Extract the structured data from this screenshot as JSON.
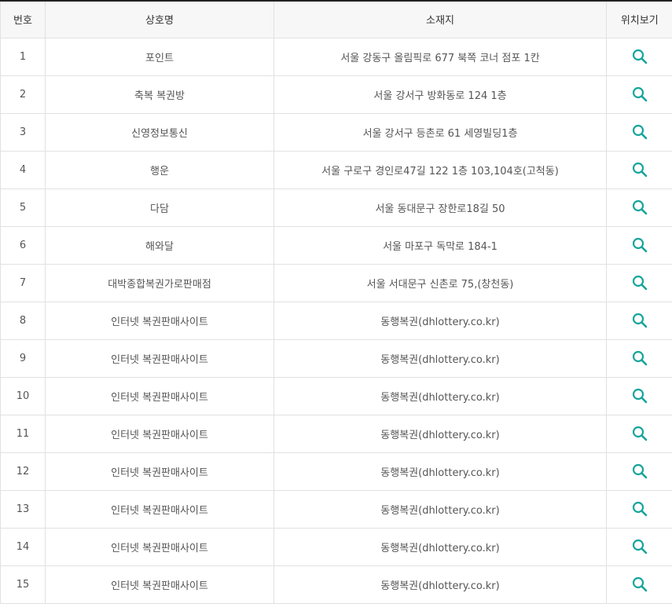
{
  "table": {
    "headers": [
      "번호",
      "상호명",
      "소재지",
      "위치보기"
    ],
    "rows": [
      {
        "num": "1",
        "name": "포인트",
        "address": "서울 강동구 올림픽로 677 북쪽 코너 점포 1칸"
      },
      {
        "num": "2",
        "name": "축복 복권방",
        "address": "서울 강서구 방화동로 124 1층"
      },
      {
        "num": "3",
        "name": "신영정보통신",
        "address": "서울 강서구 등촌로 61 세영빌딩1층"
      },
      {
        "num": "4",
        "name": "행운",
        "address": "서울 구로구 경인로47길 122 1층 103,104호(고척동)"
      },
      {
        "num": "5",
        "name": "다담",
        "address": "서울 동대문구 장한로18길 50"
      },
      {
        "num": "6",
        "name": "해와달",
        "address": "서울 마포구 독막로 184-1"
      },
      {
        "num": "7",
        "name": "대박종합복권가로판매점",
        "address": "서울 서대문구 신촌로 75,(창천동)"
      },
      {
        "num": "8",
        "name": "인터넷 복권판매사이트",
        "address": "동행복권(dhlottery.co.kr)"
      },
      {
        "num": "9",
        "name": "인터넷 복권판매사이트",
        "address": "동행복권(dhlottery.co.kr)"
      },
      {
        "num": "10",
        "name": "인터넷 복권판매사이트",
        "address": "동행복권(dhlottery.co.kr)"
      },
      {
        "num": "11",
        "name": "인터넷 복권판매사이트",
        "address": "동행복권(dhlottery.co.kr)"
      },
      {
        "num": "12",
        "name": "인터넷 복권판매사이트",
        "address": "동행복권(dhlottery.co.kr)"
      },
      {
        "num": "13",
        "name": "인터넷 복권판매사이트",
        "address": "동행복권(dhlottery.co.kr)"
      },
      {
        "num": "14",
        "name": "인터넷 복권판매사이트",
        "address": "동행복권(dhlottery.co.kr)"
      },
      {
        "num": "15",
        "name": "인터넷 복권판매사이트",
        "address": "동행복권(dhlottery.co.kr)"
      }
    ]
  },
  "icons": {
    "location": "search-icon"
  },
  "colors": {
    "accent": "#17a59b",
    "header_bg": "#f7f7f7",
    "border": "#e1e1e1",
    "text": "#555555"
  }
}
